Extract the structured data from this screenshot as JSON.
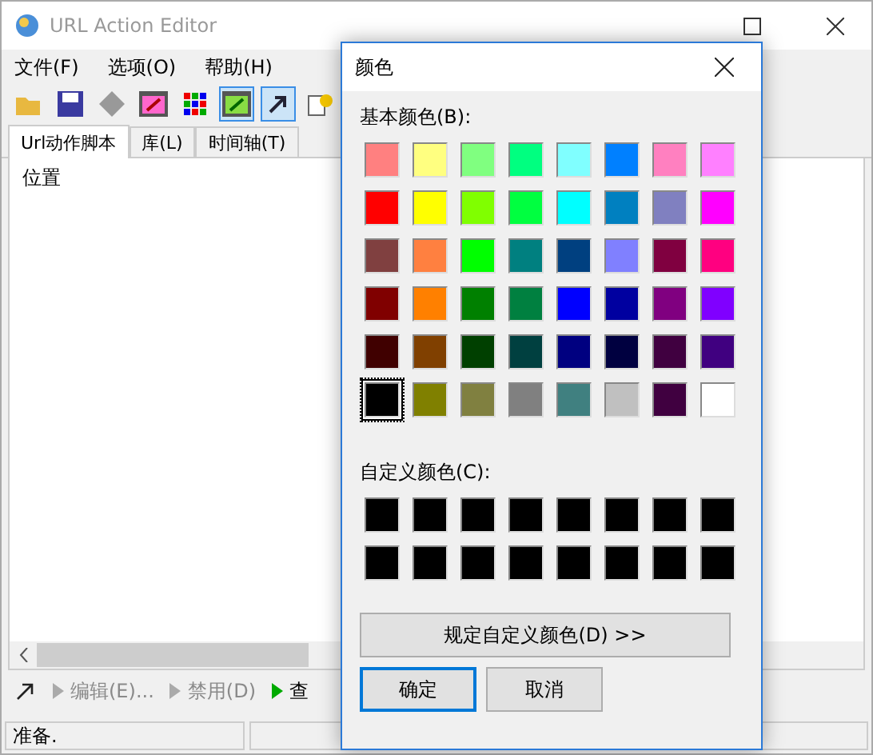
{
  "window": {
    "title": "URL Action Editor"
  },
  "menu": [
    "文件(F)",
    "选项(O)",
    "帮助(H)"
  ],
  "tabs": [
    {
      "label": "Url动作脚本",
      "selected": true
    },
    {
      "label": "库(L)",
      "selected": false
    },
    {
      "label": "时间轴(T)",
      "selected": false
    }
  ],
  "list": {
    "column": "位置"
  },
  "actions": [
    {
      "label": "编辑(E)...",
      "disabled": true
    },
    {
      "label": "禁用(D)",
      "disabled": true
    },
    {
      "label": "查",
      "disabled": false
    }
  ],
  "status_bar": {
    "text": "准备."
  },
  "dialog": {
    "title": "颜色",
    "basic_label": "基本颜色(B):",
    "basic_colors": [
      {
        "color": "#ff8080",
        "selected": false
      },
      {
        "color": "#ffff80",
        "selected": false
      },
      {
        "color": "#80ff80",
        "selected": false
      },
      {
        "color": "#00ff80",
        "selected": false
      },
      {
        "color": "#80ffff",
        "selected": false
      },
      {
        "color": "#0080ff",
        "selected": false
      },
      {
        "color": "#ff80c0",
        "selected": false
      },
      {
        "color": "#ff80ff",
        "selected": false
      },
      {
        "color": "#ff0000",
        "selected": false
      },
      {
        "color": "#ffff00",
        "selected": false
      },
      {
        "color": "#80ff00",
        "selected": false
      },
      {
        "color": "#00ff40",
        "selected": false
      },
      {
        "color": "#00ffff",
        "selected": false
      },
      {
        "color": "#0080c0",
        "selected": false
      },
      {
        "color": "#8080c0",
        "selected": false
      },
      {
        "color": "#ff00ff",
        "selected": false
      },
      {
        "color": "#804040",
        "selected": false
      },
      {
        "color": "#ff8040",
        "selected": false
      },
      {
        "color": "#00ff00",
        "selected": false
      },
      {
        "color": "#008080",
        "selected": false
      },
      {
        "color": "#004080",
        "selected": false
      },
      {
        "color": "#8080ff",
        "selected": false
      },
      {
        "color": "#800040",
        "selected": false
      },
      {
        "color": "#ff0080",
        "selected": false
      },
      {
        "color": "#800000",
        "selected": false
      },
      {
        "color": "#ff8000",
        "selected": false
      },
      {
        "color": "#008000",
        "selected": false
      },
      {
        "color": "#008040",
        "selected": false
      },
      {
        "color": "#0000ff",
        "selected": false
      },
      {
        "color": "#0000a0",
        "selected": false
      },
      {
        "color": "#800080",
        "selected": false
      },
      {
        "color": "#8000ff",
        "selected": false
      },
      {
        "color": "#400000",
        "selected": false
      },
      {
        "color": "#804000",
        "selected": false
      },
      {
        "color": "#004000",
        "selected": false
      },
      {
        "color": "#004040",
        "selected": false
      },
      {
        "color": "#000080",
        "selected": false
      },
      {
        "color": "#000040",
        "selected": false
      },
      {
        "color": "#400040",
        "selected": false
      },
      {
        "color": "#400080",
        "selected": false
      },
      {
        "color": "#000000",
        "selected": true
      },
      {
        "color": "#808000",
        "selected": false
      },
      {
        "color": "#808040",
        "selected": false
      },
      {
        "color": "#808080",
        "selected": false
      },
      {
        "color": "#408080",
        "selected": false
      },
      {
        "color": "#c0c0c0",
        "selected": false
      },
      {
        "color": "#400040",
        "selected": false
      },
      {
        "color": "#ffffff",
        "selected": false
      }
    ],
    "custom_label": "自定义颜色(C):",
    "custom_colors": [
      {
        "color": "#000000"
      },
      {
        "color": "#000000"
      },
      {
        "color": "#000000"
      },
      {
        "color": "#000000"
      },
      {
        "color": "#000000"
      },
      {
        "color": "#000000"
      },
      {
        "color": "#000000"
      },
      {
        "color": "#000000"
      },
      {
        "color": "#000000"
      },
      {
        "color": "#000000"
      },
      {
        "color": "#000000"
      },
      {
        "color": "#000000"
      },
      {
        "color": "#000000"
      },
      {
        "color": "#000000"
      },
      {
        "color": "#000000"
      },
      {
        "color": "#000000"
      }
    ],
    "define_button": "规定自定义颜色(D) >>",
    "buttons": [
      {
        "label": "确定",
        "default": true
      },
      {
        "label": "取消",
        "default": false
      }
    ]
  }
}
